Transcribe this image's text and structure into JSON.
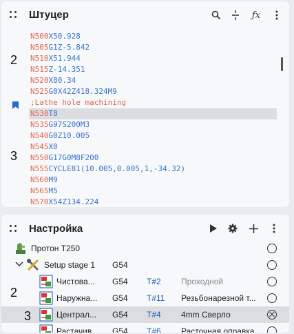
{
  "colors": {
    "block_number": "#e0654f",
    "code": "#3a74c9",
    "comment": "#e0654f",
    "tool_number": "#1a5fb4",
    "muted": "#8a8a8a"
  },
  "gcode_panel": {
    "title": "Штуцер",
    "icons": [
      "search-icon",
      "split-icon",
      "formula-icon",
      "more-vertical-icon"
    ],
    "lines": [
      {
        "n": "N500",
        "rest": "X50.928"
      },
      {
        "n": "N505",
        "rest": "G1Z-5.842"
      },
      {
        "n": "N510",
        "rest": "X51.944"
      },
      {
        "n": "N515",
        "rest": "Z-14.351"
      },
      {
        "n": "N520",
        "rest": "X80.34"
      },
      {
        "n": "N525",
        "rest": "G0X42Z418.324M9"
      },
      {
        "n": "",
        "rest": ";Lathe hole machining",
        "comment": true
      },
      {
        "n": "N530",
        "rest": "T8",
        "selected": true
      },
      {
        "n": "N535",
        "rest": "G97S200M3"
      },
      {
        "n": "N540",
        "rest": "G0Z10.005"
      },
      {
        "n": "N545",
        "rest": "X0"
      },
      {
        "n": "N550",
        "rest": "G17G0M8F200"
      },
      {
        "n": "N555",
        "rest": "CYCLE81(10.005,0.005,1,-34.32)"
      },
      {
        "n": "N560",
        "rest": "M9"
      },
      {
        "n": "N565",
        "rest": "M5"
      },
      {
        "n": "N570",
        "rest": "X54Z134.224"
      }
    ],
    "overlays": [
      "2",
      "3"
    ]
  },
  "setup_panel": {
    "title": "Настройка",
    "icons": [
      "play-icon",
      "gear-icon",
      "plus-icon",
      "more-vertical-icon"
    ],
    "machine": {
      "name": "Протон T250"
    },
    "setup": {
      "name": "Setup stage 1",
      "wcs": "G54"
    },
    "operations": [
      {
        "name": "Чистова...",
        "wcs": "G54",
        "tool": "T#2",
        "tool_desc": "Проходной",
        "desc_muted": true
      },
      {
        "name": "Наружна...",
        "wcs": "G54",
        "tool": "T#11",
        "tool_desc": "Резьбонарезной т...",
        "desc_muted": false
      },
      {
        "name": "Централ...",
        "wcs": "G54",
        "tool": "T#4",
        "tool_desc": "4mm Сверло",
        "desc_muted": false,
        "selected": true
      },
      {
        "name": "Растачив...",
        "wcs": "G54",
        "tool": "T#6",
        "tool_desc": "Расточная оправка",
        "desc_muted": false
      }
    ],
    "overlays": [
      "2",
      "3"
    ]
  }
}
